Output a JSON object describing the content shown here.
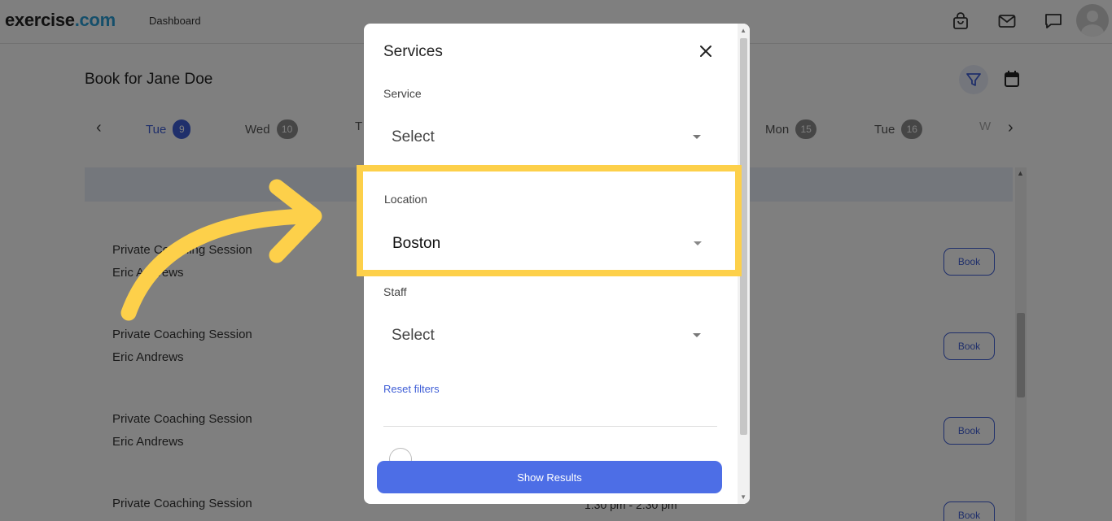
{
  "header": {
    "logo_main": "exercise",
    "logo_dot": ".com",
    "nav_link": "Dashboard",
    "icons": [
      "shopping-bag-icon",
      "mail-icon",
      "chat-icon",
      "avatar"
    ]
  },
  "booking": {
    "title": "Book for Jane Doe",
    "days": [
      {
        "label": "Tue",
        "num": "9",
        "active": true
      },
      {
        "label": "Wed",
        "num": "10"
      },
      {
        "label": "Mon",
        "num": "15"
      },
      {
        "label": "Tue",
        "num": "16"
      }
    ],
    "partial_day_left": "T",
    "partial_day_right": "W",
    "sessions": [
      {
        "title": "Private Coaching Session",
        "coach": "Eric Andrews",
        "button": "Book"
      },
      {
        "title": "Private Coaching Session",
        "coach": "Eric Andrews",
        "button": "Book"
      },
      {
        "title": "Private Coaching Session",
        "coach": "Eric Andrews",
        "button": "Book"
      },
      {
        "title": "Private Coaching Session",
        "coach": "",
        "button": "Book"
      }
    ],
    "partial_time": "1:30 pm - 2:30 pm"
  },
  "modal": {
    "title": "Services",
    "service": {
      "label": "Service",
      "value": "Select"
    },
    "location": {
      "label": "Location",
      "value": "Boston"
    },
    "staff": {
      "label": "Staff",
      "value": "Select"
    },
    "reset_label": "Reset filters",
    "show_results_label": "Show Results"
  },
  "colors": {
    "accent": "#3f5ed6",
    "button_primary": "#4d6ee6",
    "highlight": "#fdd04a",
    "logo_dot": "#2a9fd6"
  }
}
